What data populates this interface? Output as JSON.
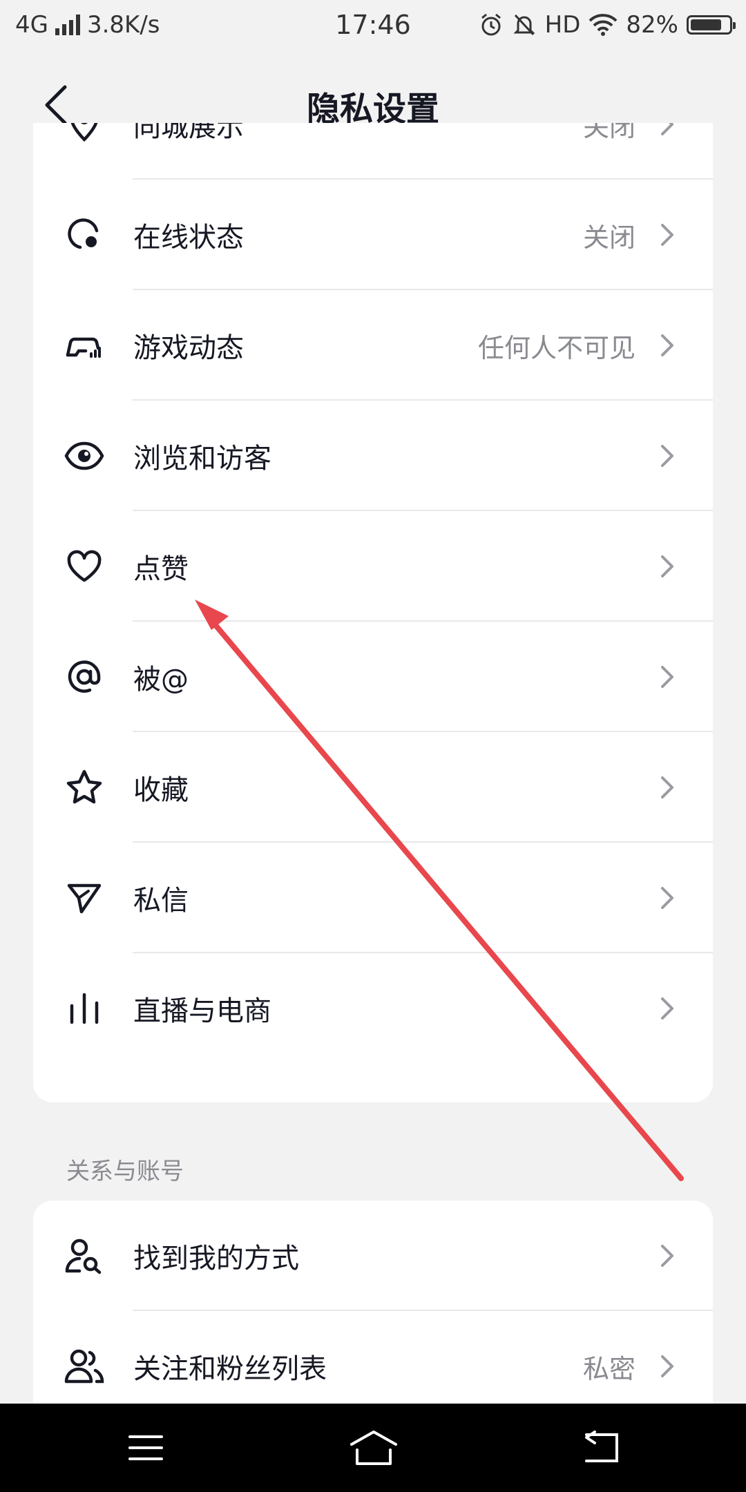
{
  "status_bar": {
    "network": "4G",
    "speed": "3.8K/s",
    "time": "17:46",
    "hd": "HD",
    "battery": "82%",
    "battery_level": 0.82
  },
  "header": {
    "title": "隐私设置"
  },
  "privacy_items": [
    {
      "label": "同城展示",
      "value": "关闭",
      "icon": "location-pin-icon"
    },
    {
      "label": "在线状态",
      "value": "关闭",
      "icon": "online-status-icon"
    },
    {
      "label": "游戏动态",
      "value": "任何人不可见",
      "icon": "gamepad-icon"
    },
    {
      "label": "浏览和访客",
      "value": "",
      "icon": "eye-icon"
    },
    {
      "label": "点赞",
      "value": "",
      "icon": "heart-icon"
    },
    {
      "label": "被@",
      "value": "",
      "icon": "at-sign-icon"
    },
    {
      "label": "收藏",
      "value": "",
      "icon": "star-icon"
    },
    {
      "label": "私信",
      "value": "",
      "icon": "send-icon"
    },
    {
      "label": "直播与电商",
      "value": "",
      "icon": "bars-icon"
    }
  ],
  "relations_section": {
    "title": "关系与账号",
    "items": [
      {
        "label": "找到我的方式",
        "value": "",
        "icon": "person-search-icon"
      },
      {
        "label": "关注和粉丝列表",
        "value": "私密",
        "icon": "people-icon"
      }
    ]
  },
  "annotation": {
    "color": "#e8474d"
  },
  "system_nav": {
    "icons": [
      "menu-icon",
      "home-icon",
      "back-icon"
    ]
  }
}
